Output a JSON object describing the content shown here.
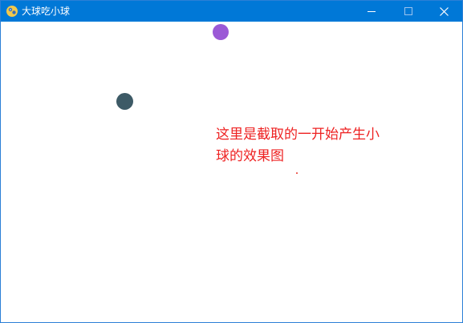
{
  "window": {
    "title": "大球吃小球",
    "app_icon": "pygame-snake-icon",
    "titlebar_color": "#0078d7",
    "controls": {
      "minimize_icon": "minimize-icon",
      "maximize_icon": "maximize-icon",
      "close_icon": "close-icon"
    }
  },
  "canvas": {
    "background": "#ffffff",
    "balls": [
      {
        "name": "ball-purple",
        "color": "#9b59d6"
      },
      {
        "name": "ball-slate",
        "color": "#3d5a66"
      },
      {
        "name": "ball-red-tiny",
        "color": "#e8332a"
      }
    ],
    "annotation": {
      "line1": "这里是截取的一开始产生小",
      "line2": "球的效果图",
      "color": "#ee2222"
    }
  }
}
